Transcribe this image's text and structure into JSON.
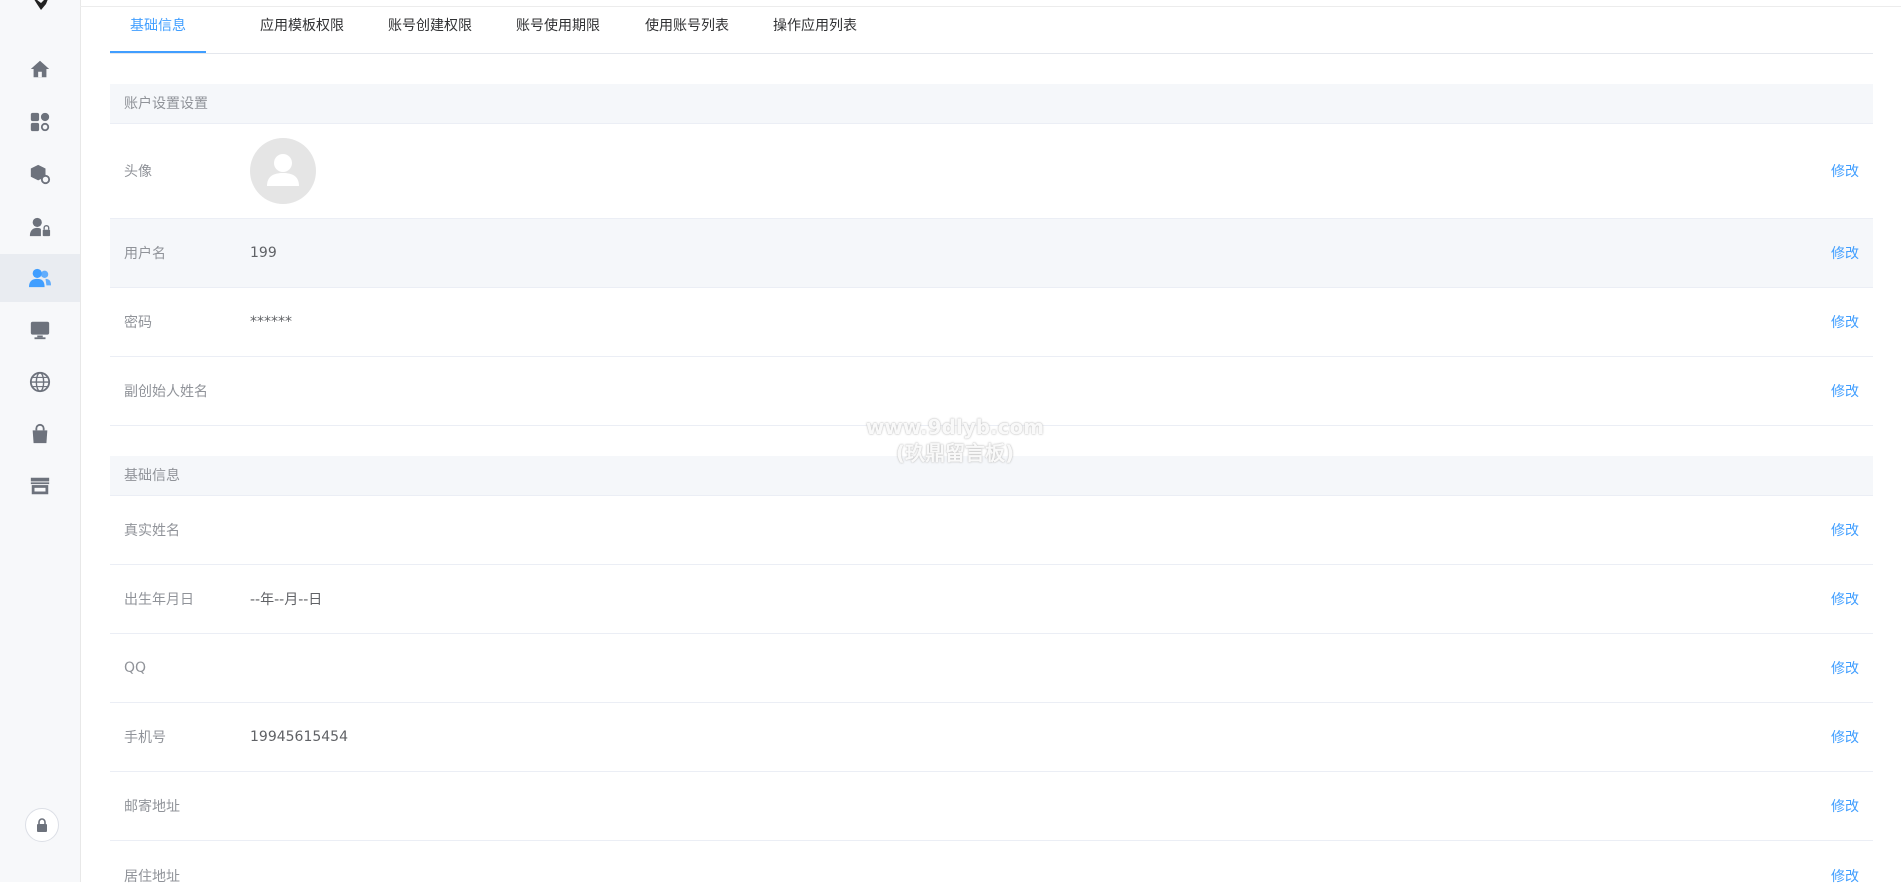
{
  "colors": {
    "accent": "#409eff",
    "sidebar_bg": "#f7f8fa",
    "icon": "#6d727c",
    "active_icon": "#409eff"
  },
  "sidebar": {
    "logo_icon": "bird-logo-icon",
    "items": [
      {
        "icon": "home-icon"
      },
      {
        "icon": "apps-icon"
      },
      {
        "icon": "package-settings-icon"
      },
      {
        "icon": "user-lock-icon"
      },
      {
        "icon": "users-icon",
        "active": true
      },
      {
        "icon": "monitor-icon"
      },
      {
        "icon": "globe-icon"
      },
      {
        "icon": "shopping-bag-icon"
      },
      {
        "icon": "store-icon"
      }
    ],
    "bottom_icon": "lock-icon"
  },
  "tabs": [
    {
      "label": "基础信息",
      "active": true
    },
    {
      "label": "应用模板权限"
    },
    {
      "label": "账号创建权限"
    },
    {
      "label": "账号使用期限"
    },
    {
      "label": "使用账号列表"
    },
    {
      "label": "操作应用列表"
    }
  ],
  "account_section": {
    "title": "账户设置设置",
    "rows": [
      {
        "label": "头像",
        "value": "",
        "edit": "修改",
        "avatar_icon": "default-avatar-icon"
      },
      {
        "label": "用户名",
        "value": "199",
        "edit": "修改"
      },
      {
        "label": "密码",
        "value": "******",
        "edit": "修改"
      },
      {
        "label": "副创始人姓名",
        "value": "",
        "edit": "修改"
      }
    ]
  },
  "basic_section": {
    "title": "基础信息",
    "rows": [
      {
        "label": "真实姓名",
        "value": "",
        "edit": "修改"
      },
      {
        "label": "出生年月日",
        "value": "--年--月--日",
        "edit": "修改"
      },
      {
        "label": "QQ",
        "value": "",
        "edit": "修改"
      },
      {
        "label": "手机号",
        "value": "19945615454",
        "edit": "修改"
      },
      {
        "label": "邮寄地址",
        "value": "",
        "edit": "修改"
      },
      {
        "label": "居住地址",
        "value": "",
        "edit": "修改"
      }
    ]
  },
  "watermark": {
    "line1": "www.9dlyb.com",
    "line2": "(玖鼎留言板)"
  }
}
